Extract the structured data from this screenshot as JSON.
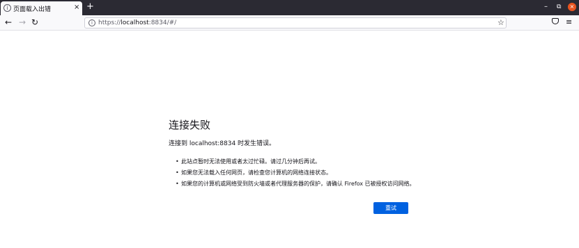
{
  "tab": {
    "icon": "info-circle-icon",
    "title": "页面载入出错",
    "close_glyph": "×"
  },
  "tabs_bar": {
    "new_tab_glyph": "+"
  },
  "window_controls": {
    "minimize_glyph": "–",
    "maximize_glyph": "⧉",
    "close_glyph": "×",
    "close_color": "#e95420"
  },
  "navigation": {
    "back_glyph": "←",
    "forward_glyph": "→",
    "reload_glyph": "↻"
  },
  "url_bar": {
    "scheme": "https://",
    "host": "localhost",
    "rest": ":8834/#/",
    "bookmark_glyph": "☆"
  },
  "toolbar": {
    "pocket_icon": "pocket-icon",
    "menu_glyph": "≡"
  },
  "error": {
    "title": "连接失败",
    "description": "连接到 localhost:8834 时发生错误。",
    "bullet_glyph": "•",
    "items": [
      "此站点暂时无法使用或者太过忙碌。请过几分钟后再试。",
      "如果您无法载入任何网页，请检查您计算机的网络连接状态。",
      "如果您的计算机或网络受到防火墙或者代理服务器的保护，请确认 Firefox 已被授权访问网络。"
    ],
    "retry_label": "重试",
    "retry_color": "#0061e0"
  }
}
